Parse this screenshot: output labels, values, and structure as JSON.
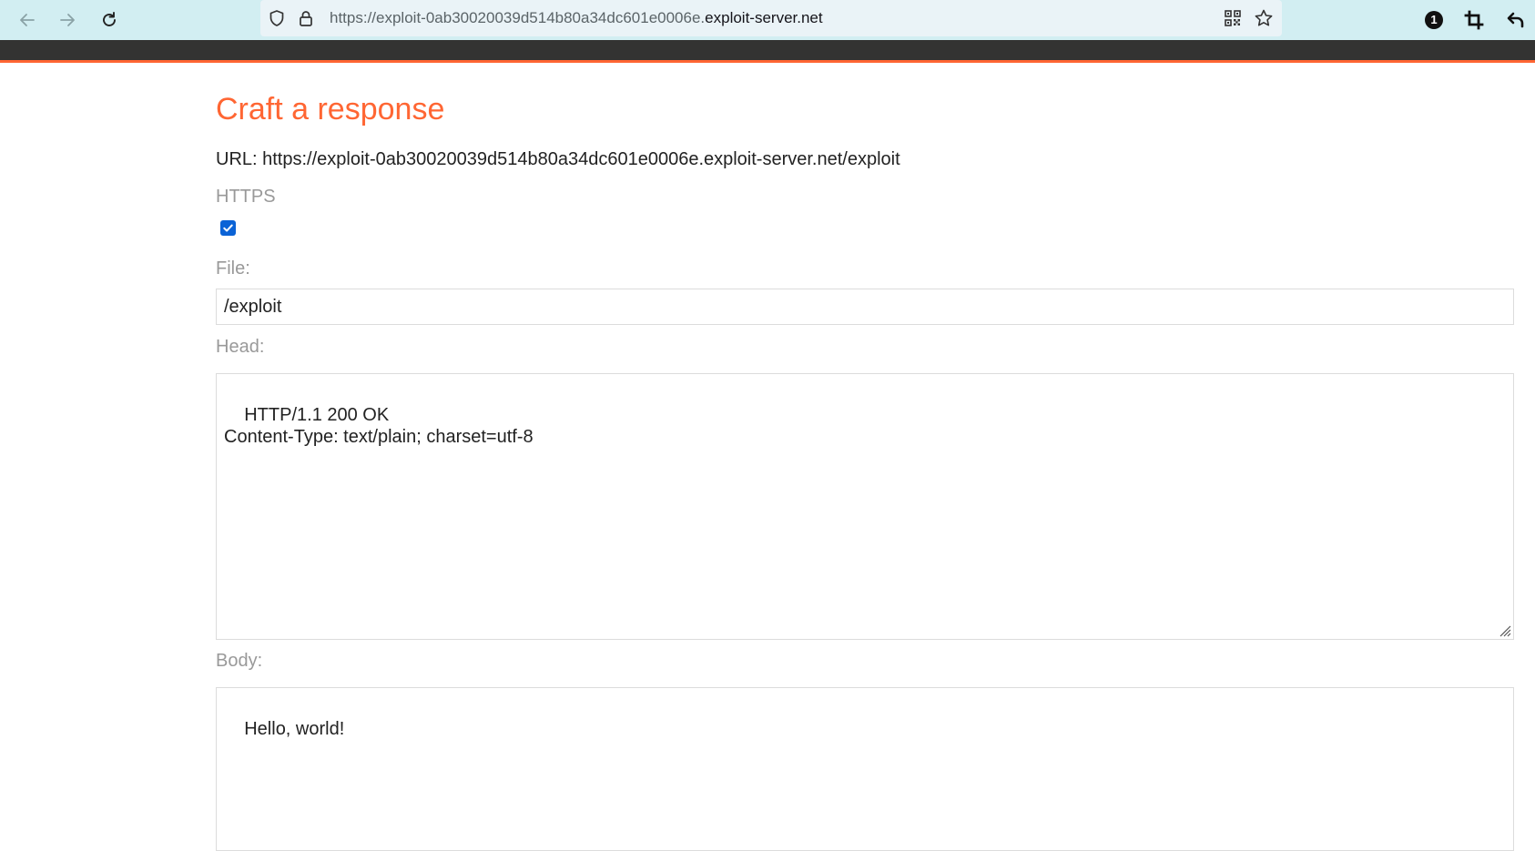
{
  "browser": {
    "url_prefix": "https://exploit-0ab30020039d514b80a34dc601e0006e.",
    "url_domain": "exploit-server.net",
    "extension_badge": "1"
  },
  "page": {
    "title": "Craft a response",
    "url_label": "URL: https://exploit-0ab30020039d514b80a34dc601e0006e.exploit-server.net/exploit",
    "https_label": "HTTPS",
    "https_checked": true,
    "file_label": "File:",
    "file_value": "/exploit",
    "head_label": "Head:",
    "head_value": "HTTP/1.1 200 OK\nContent-Type: text/plain; charset=utf-8",
    "body_label": "Body:",
    "body_value": "Hello, world!"
  },
  "colors": {
    "accent": "#ff6633",
    "toolbar": "#d2eef2",
    "header_bar": "#333332",
    "checkbox": "#0b63d6"
  }
}
